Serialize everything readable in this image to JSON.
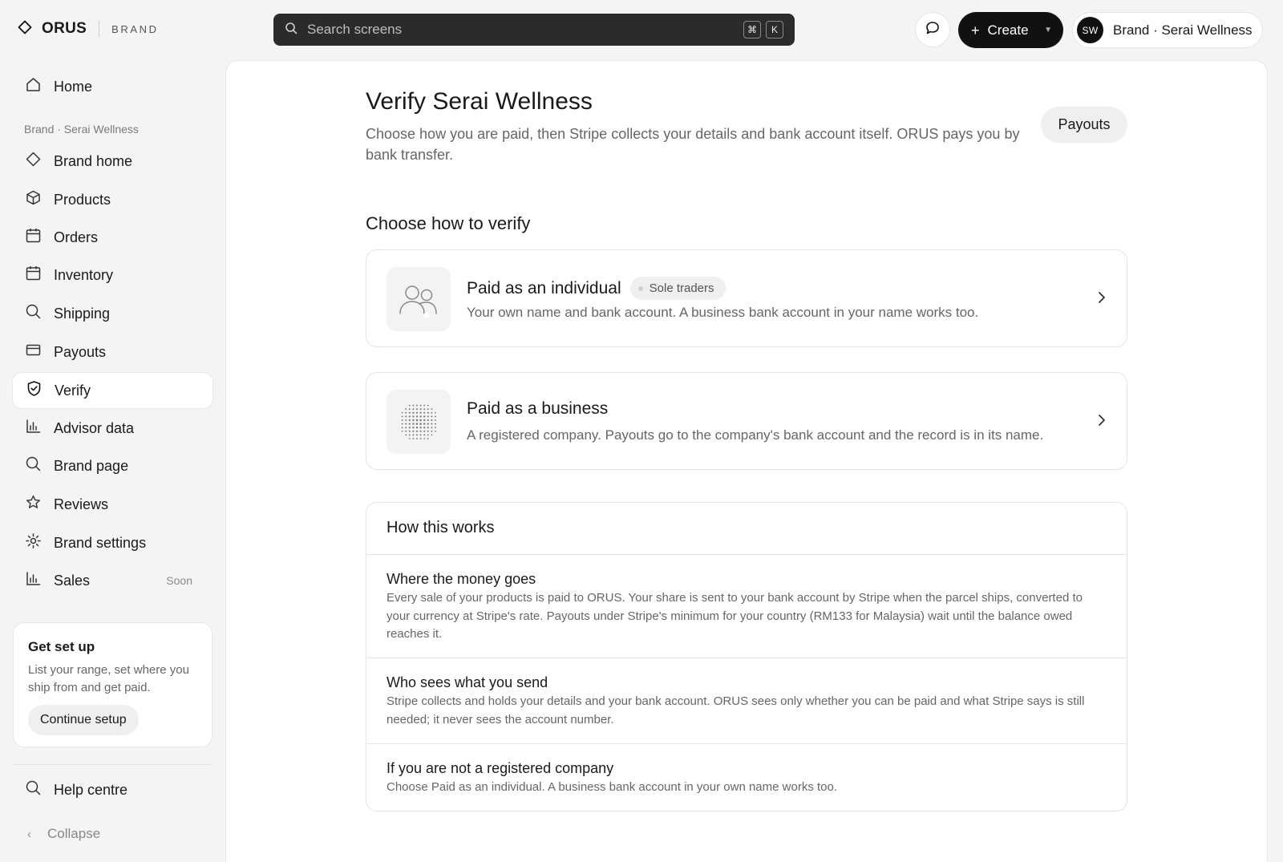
{
  "header": {
    "logo_icon": "diamond-icon",
    "brand_name": "ORUS",
    "brand_tag": "BRAND",
    "search_placeholder": "Search screens",
    "shortcut_keys": [
      "⌘",
      "K"
    ],
    "create_label": "Create",
    "account_initials": "SW",
    "account_name": "Brand · Serai Wellness"
  },
  "sidebar": {
    "home_label": "Home",
    "section_label": "Brand · Serai Wellness",
    "items": [
      {
        "label": "Brand home",
        "icon": "diamond-icon"
      },
      {
        "label": "Products",
        "icon": "box-icon"
      },
      {
        "label": "Orders",
        "icon": "calendar-icon"
      },
      {
        "label": "Inventory",
        "icon": "calendar-icon"
      },
      {
        "label": "Shipping",
        "icon": "search-icon"
      },
      {
        "label": "Payouts",
        "icon": "wallet-icon"
      },
      {
        "label": "Verify",
        "icon": "shield-check-icon",
        "active": true
      },
      {
        "label": "Advisor data",
        "icon": "bar-chart-icon"
      },
      {
        "label": "Brand page",
        "icon": "search-icon"
      },
      {
        "label": "Reviews",
        "icon": "star-icon"
      },
      {
        "label": "Brand settings",
        "icon": "gear-icon"
      },
      {
        "label": "Sales",
        "icon": "bar-chart-icon",
        "badge": "Soon"
      }
    ],
    "setup": {
      "title": "Get set up",
      "text": "List your range, set where you ship from and get paid.",
      "button": "Continue setup"
    },
    "help_label": "Help centre",
    "collapse_label": "Collapse"
  },
  "main": {
    "title": "Verify Serai Wellness",
    "subtitle": "Choose how you are paid, then Stripe collects your details and bank account itself. ORUS pays you by bank transfer.",
    "payouts_button": "Payouts",
    "section_title": "Choose how to verify",
    "options": [
      {
        "title": "Paid as an individual",
        "badge": "Sole traders",
        "description": "Your own name and bank account. A business bank account in your name works too.",
        "icon": "people-icon"
      },
      {
        "title": "Paid as a business",
        "description": "A registered company. Payouts go to the company's bank account and the record is in its name.",
        "icon": "building-dots-icon"
      }
    ],
    "how": {
      "title": "How this works",
      "rows": [
        {
          "title": "Where the money goes",
          "text": "Every sale of your products is paid to ORUS. Your share is sent to your bank account by Stripe when the parcel ships, converted to your currency at Stripe's rate. Payouts under Stripe's minimum for your country (RM133 for Malaysia) wait until the balance owed reaches it."
        },
        {
          "title": "Who sees what you send",
          "text": "Stripe collects and holds your details and your bank account. ORUS sees only whether you can be paid and what Stripe says is still needed; it never sees the account number."
        },
        {
          "title": "If you are not a registered company",
          "text": "Choose Paid as an individual. A business bank account in your own name works too."
        }
      ]
    }
  }
}
